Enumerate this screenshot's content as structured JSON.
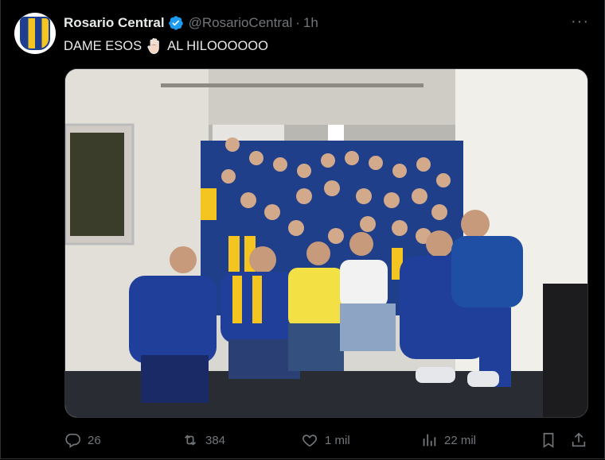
{
  "tweet": {
    "author_name": "Rosario Central",
    "handle": "@RosarioCentral",
    "separator": "·",
    "time": "1h",
    "text_before": "DAME ESOS",
    "text_after": "AL HILOOOOOO",
    "emoji": "raised-hand",
    "more_label": "···"
  },
  "media": {
    "description_icon": "team-celebration-photo"
  },
  "actions": {
    "replies": "26",
    "reposts": "384",
    "likes": "1 mil",
    "views": "22 mil"
  },
  "colors": {
    "background": "#000000",
    "text": "#e7e9ea",
    "muted": "#71767b",
    "verified": "#1d9bf0",
    "team_blue": "#1e3f8f",
    "team_yellow": "#f4c520"
  }
}
